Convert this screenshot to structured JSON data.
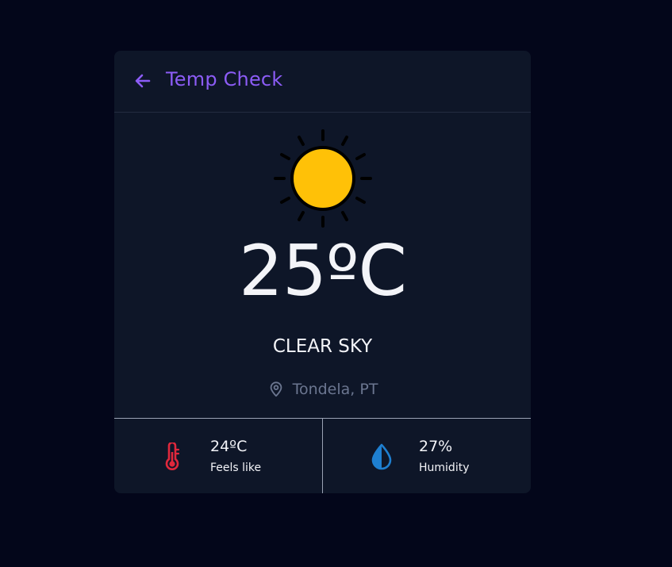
{
  "header": {
    "back_icon": "arrow-left-icon",
    "title": "Temp Check"
  },
  "weather": {
    "icon": "sun-icon",
    "temperature": "25ºC",
    "condition": "CLEAR SKY"
  },
  "location": {
    "icon": "map-pin-icon",
    "name": "Tondela, PT"
  },
  "stats": [
    {
      "icon": "thermometer-icon",
      "value": "24ºC",
      "label": "Feels like",
      "color": "#e0283c"
    },
    {
      "icon": "water-drop-icon",
      "value": "27%",
      "label": "Humidity",
      "color": "#1e7fd0"
    }
  ],
  "colors": {
    "background": "#03061a",
    "card": "#0e1628",
    "accent": "#8c5cf6",
    "sun": "#ffc107",
    "muted": "#6b7690"
  }
}
